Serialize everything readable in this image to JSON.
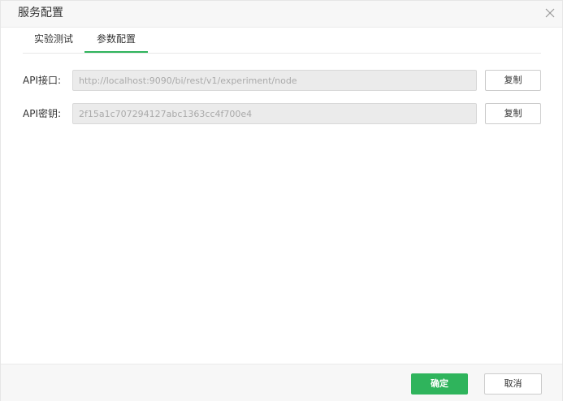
{
  "dialog": {
    "title": "服务配置",
    "close_icon": "close-icon"
  },
  "tabs": [
    {
      "label": "实验测试",
      "active": false
    },
    {
      "label": "参数配置",
      "active": true
    }
  ],
  "fields": [
    {
      "label": "API接口:",
      "value": "http://localhost:9090/bi/rest/v1/experiment/node",
      "button": "复制"
    },
    {
      "label": "API密钥:",
      "value": "2f15a1c707294127abc1363cc4f700e4",
      "button": "复制"
    }
  ],
  "footer": {
    "ok_label": "确定",
    "cancel_label": "取消"
  },
  "colors": {
    "accent": "#2fb45c",
    "input_bg": "#ebebeb",
    "header_bg": "#f7f7f7"
  }
}
